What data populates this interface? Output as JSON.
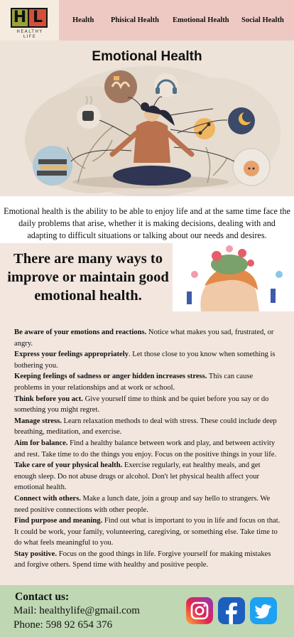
{
  "logo": {
    "letters": [
      "H",
      "L"
    ],
    "tagline": "HEALTHY LIFE"
  },
  "nav": {
    "items": [
      "Health",
      "Phisical Health",
      "Emotional Health",
      "Social Health"
    ]
  },
  "hero": {
    "title": "Emotional Health"
  },
  "intro": {
    "text": "Emotional health is the ability to be able to enjoy life and at the same time face the daily problems that arise, whether it is making decisions, dealing with and adapting to difficult situations or talking about our needs and desires."
  },
  "ways": {
    "title": "There are many ways to improve or maintain good emotional health."
  },
  "tips": [
    {
      "bold": "Be aware of your emotions and reactions.",
      "text": " Notice what makes you sad, frustrated, or angry."
    },
    {
      "bold": "Express your feelings appropriately",
      "text": ". Let those close to you know when something is bothering you."
    },
    {
      "bold": "Keeping feelings of sadness or anger hidden increases stress.",
      "text": " This can cause problems in your relationships and at work or school."
    },
    {
      "bold": "Think before you act.",
      "text": " Give yourself time to think and be quiet before you say or do something you might regret."
    },
    {
      "bold": "Manage stress.",
      "text": " Learn relaxation methods to deal with stress. These could include deep breathing, meditation, and exercise."
    },
    {
      "bold": "Aim for balance.",
      "text": " Find a healthy balance between work and play, and between activity and rest. Take time to do the things you enjoy. Focus on the positive things in your life."
    },
    {
      "bold": "Take care of your physical health.",
      "text": " Exercise regularly, eat healthy meals, and get enough sleep. Do not abuse drugs or alcohol. Don't let physical health affect your emotional health."
    },
    {
      "bold": "Connect with others.",
      "text": " Make a lunch date, join a group and say hello to strangers. We need positive connections with other people."
    },
    {
      "bold": "Find purpose and meaning.",
      "text": " Find out what is important to you in life and focus on that. It could be work, your family, volunteering, caregiving, or something else. Take time to do what feels meaningful to you."
    },
    {
      "bold": "Stay positive.",
      "text": " Focus on the good things in life. Forgive yourself for making mistakes and forgive others. Spend time with healthy and positive people."
    }
  ],
  "footer": {
    "title": "Contact us:",
    "mail": "Mail: healthylife@gmail.com",
    "phone": "Phone: 598 92 654 376"
  },
  "social_icons": [
    "instagram-icon",
    "facebook-icon",
    "twitter-icon"
  ],
  "colors": {
    "header": "#eec9c4",
    "page": "#f2e6de",
    "footer": "#bfd7b3",
    "facebook": "#1877f2",
    "twitter": "#1da1f2"
  }
}
